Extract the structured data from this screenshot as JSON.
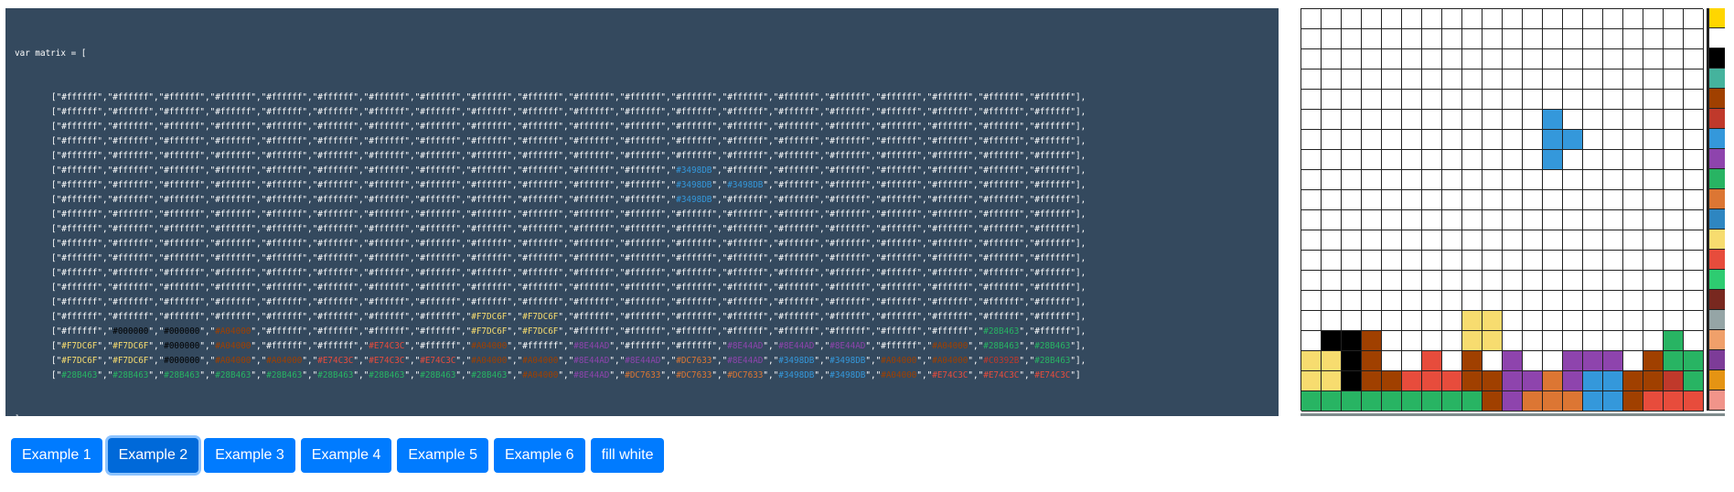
{
  "code": {
    "open_line": "var matrix = [",
    "close_line": "]"
  },
  "matrix": [
    [
      "#ffffff",
      "#ffffff",
      "#ffffff",
      "#ffffff",
      "#ffffff",
      "#ffffff",
      "#ffffff",
      "#ffffff",
      "#ffffff",
      "#ffffff",
      "#ffffff",
      "#ffffff",
      "#ffffff",
      "#ffffff",
      "#ffffff",
      "#ffffff",
      "#ffffff",
      "#ffffff",
      "#ffffff",
      "#ffffff"
    ],
    [
      "#ffffff",
      "#ffffff",
      "#ffffff",
      "#ffffff",
      "#ffffff",
      "#ffffff",
      "#ffffff",
      "#ffffff",
      "#ffffff",
      "#ffffff",
      "#ffffff",
      "#ffffff",
      "#ffffff",
      "#ffffff",
      "#ffffff",
      "#ffffff",
      "#ffffff",
      "#ffffff",
      "#ffffff",
      "#ffffff"
    ],
    [
      "#ffffff",
      "#ffffff",
      "#ffffff",
      "#ffffff",
      "#ffffff",
      "#ffffff",
      "#ffffff",
      "#ffffff",
      "#ffffff",
      "#ffffff",
      "#ffffff",
      "#ffffff",
      "#ffffff",
      "#ffffff",
      "#ffffff",
      "#ffffff",
      "#ffffff",
      "#ffffff",
      "#ffffff",
      "#ffffff"
    ],
    [
      "#ffffff",
      "#ffffff",
      "#ffffff",
      "#ffffff",
      "#ffffff",
      "#ffffff",
      "#ffffff",
      "#ffffff",
      "#ffffff",
      "#ffffff",
      "#ffffff",
      "#ffffff",
      "#ffffff",
      "#ffffff",
      "#ffffff",
      "#ffffff",
      "#ffffff",
      "#ffffff",
      "#ffffff",
      "#ffffff"
    ],
    [
      "#ffffff",
      "#ffffff",
      "#ffffff",
      "#ffffff",
      "#ffffff",
      "#ffffff",
      "#ffffff",
      "#ffffff",
      "#ffffff",
      "#ffffff",
      "#ffffff",
      "#ffffff",
      "#ffffff",
      "#ffffff",
      "#ffffff",
      "#ffffff",
      "#ffffff",
      "#ffffff",
      "#ffffff",
      "#ffffff"
    ],
    [
      "#ffffff",
      "#ffffff",
      "#ffffff",
      "#ffffff",
      "#ffffff",
      "#ffffff",
      "#ffffff",
      "#ffffff",
      "#ffffff",
      "#ffffff",
      "#ffffff",
      "#ffffff",
      "#3498DB",
      "#ffffff",
      "#ffffff",
      "#ffffff",
      "#ffffff",
      "#ffffff",
      "#ffffff",
      "#ffffff"
    ],
    [
      "#ffffff",
      "#ffffff",
      "#ffffff",
      "#ffffff",
      "#ffffff",
      "#ffffff",
      "#ffffff",
      "#ffffff",
      "#ffffff",
      "#ffffff",
      "#ffffff",
      "#ffffff",
      "#3498DB",
      "#3498DB",
      "#ffffff",
      "#ffffff",
      "#ffffff",
      "#ffffff",
      "#ffffff",
      "#ffffff"
    ],
    [
      "#ffffff",
      "#ffffff",
      "#ffffff",
      "#ffffff",
      "#ffffff",
      "#ffffff",
      "#ffffff",
      "#ffffff",
      "#ffffff",
      "#ffffff",
      "#ffffff",
      "#ffffff",
      "#3498DB",
      "#ffffff",
      "#ffffff",
      "#ffffff",
      "#ffffff",
      "#ffffff",
      "#ffffff",
      "#ffffff"
    ],
    [
      "#ffffff",
      "#ffffff",
      "#ffffff",
      "#ffffff",
      "#ffffff",
      "#ffffff",
      "#ffffff",
      "#ffffff",
      "#ffffff",
      "#ffffff",
      "#ffffff",
      "#ffffff",
      "#ffffff",
      "#ffffff",
      "#ffffff",
      "#ffffff",
      "#ffffff",
      "#ffffff",
      "#ffffff",
      "#ffffff"
    ],
    [
      "#ffffff",
      "#ffffff",
      "#ffffff",
      "#ffffff",
      "#ffffff",
      "#ffffff",
      "#ffffff",
      "#ffffff",
      "#ffffff",
      "#ffffff",
      "#ffffff",
      "#ffffff",
      "#ffffff",
      "#ffffff",
      "#ffffff",
      "#ffffff",
      "#ffffff",
      "#ffffff",
      "#ffffff",
      "#ffffff"
    ],
    [
      "#ffffff",
      "#ffffff",
      "#ffffff",
      "#ffffff",
      "#ffffff",
      "#ffffff",
      "#ffffff",
      "#ffffff",
      "#ffffff",
      "#ffffff",
      "#ffffff",
      "#ffffff",
      "#ffffff",
      "#ffffff",
      "#ffffff",
      "#ffffff",
      "#ffffff",
      "#ffffff",
      "#ffffff",
      "#ffffff"
    ],
    [
      "#ffffff",
      "#ffffff",
      "#ffffff",
      "#ffffff",
      "#ffffff",
      "#ffffff",
      "#ffffff",
      "#ffffff",
      "#ffffff",
      "#ffffff",
      "#ffffff",
      "#ffffff",
      "#ffffff",
      "#ffffff",
      "#ffffff",
      "#ffffff",
      "#ffffff",
      "#ffffff",
      "#ffffff",
      "#ffffff"
    ],
    [
      "#ffffff",
      "#ffffff",
      "#ffffff",
      "#ffffff",
      "#ffffff",
      "#ffffff",
      "#ffffff",
      "#ffffff",
      "#ffffff",
      "#ffffff",
      "#ffffff",
      "#ffffff",
      "#ffffff",
      "#ffffff",
      "#ffffff",
      "#ffffff",
      "#ffffff",
      "#ffffff",
      "#ffffff",
      "#ffffff"
    ],
    [
      "#ffffff",
      "#ffffff",
      "#ffffff",
      "#ffffff",
      "#ffffff",
      "#ffffff",
      "#ffffff",
      "#ffffff",
      "#ffffff",
      "#ffffff",
      "#ffffff",
      "#ffffff",
      "#ffffff",
      "#ffffff",
      "#ffffff",
      "#ffffff",
      "#ffffff",
      "#ffffff",
      "#ffffff",
      "#ffffff"
    ],
    [
      "#ffffff",
      "#ffffff",
      "#ffffff",
      "#ffffff",
      "#ffffff",
      "#ffffff",
      "#ffffff",
      "#ffffff",
      "#ffffff",
      "#ffffff",
      "#ffffff",
      "#ffffff",
      "#ffffff",
      "#ffffff",
      "#ffffff",
      "#ffffff",
      "#ffffff",
      "#ffffff",
      "#ffffff",
      "#ffffff"
    ],
    [
      "#ffffff",
      "#ffffff",
      "#ffffff",
      "#ffffff",
      "#ffffff",
      "#ffffff",
      "#ffffff",
      "#ffffff",
      "#F7DC6F",
      "#F7DC6F",
      "#ffffff",
      "#ffffff",
      "#ffffff",
      "#ffffff",
      "#ffffff",
      "#ffffff",
      "#ffffff",
      "#ffffff",
      "#ffffff",
      "#ffffff"
    ],
    [
      "#ffffff",
      "#000000",
      "#000000",
      "#A04000",
      "#ffffff",
      "#ffffff",
      "#ffffff",
      "#ffffff",
      "#F7DC6F",
      "#F7DC6F",
      "#ffffff",
      "#ffffff",
      "#ffffff",
      "#ffffff",
      "#ffffff",
      "#ffffff",
      "#ffffff",
      "#ffffff",
      "#28B463",
      "#ffffff"
    ],
    [
      "#F7DC6F",
      "#F7DC6F",
      "#000000",
      "#A04000",
      "#ffffff",
      "#ffffff",
      "#E74C3C",
      "#ffffff",
      "#A04000",
      "#ffffff",
      "#8E44AD",
      "#ffffff",
      "#ffffff",
      "#8E44AD",
      "#8E44AD",
      "#8E44AD",
      "#ffffff",
      "#A04000",
      "#28B463",
      "#28B463"
    ],
    [
      "#F7DC6F",
      "#F7DC6F",
      "#000000",
      "#A04000",
      "#A04000",
      "#E74C3C",
      "#E74C3C",
      "#E74C3C",
      "#A04000",
      "#A04000",
      "#8E44AD",
      "#8E44AD",
      "#DC7633",
      "#8E44AD",
      "#3498DB",
      "#3498DB",
      "#A04000",
      "#A04000",
      "#C0392B",
      "#28B463"
    ],
    [
      "#28B463",
      "#28B463",
      "#28B463",
      "#28B463",
      "#28B463",
      "#28B463",
      "#28B463",
      "#28B463",
      "#28B463",
      "#A04000",
      "#8E44AD",
      "#DC7633",
      "#DC7633",
      "#DC7633",
      "#3498DB",
      "#3498DB",
      "#A04000",
      "#E74C3C",
      "#E74C3C",
      "#E74C3C"
    ]
  ],
  "palette": [
    "#FFD600",
    "#ffffff",
    "#000000",
    "#45B39D",
    "#A04000",
    "#C0392B",
    "#3498DB",
    "#8E44AD",
    "#28B463",
    "#DC7633",
    "#2E86C1",
    "#F7DC6F",
    "#E74C3C",
    "#2ECC71",
    "#78281F",
    "#95A5A6",
    "#F0A06A",
    "#7D3C98",
    "#E59413",
    "#F1948A"
  ],
  "buttons": [
    {
      "label": "Example 1"
    },
    {
      "label": "Example 2"
    },
    {
      "label": "Example 3"
    },
    {
      "label": "Example 4"
    },
    {
      "label": "Example 5"
    },
    {
      "label": "Example 6"
    },
    {
      "label": "fill white"
    }
  ],
  "active_button": 1
}
